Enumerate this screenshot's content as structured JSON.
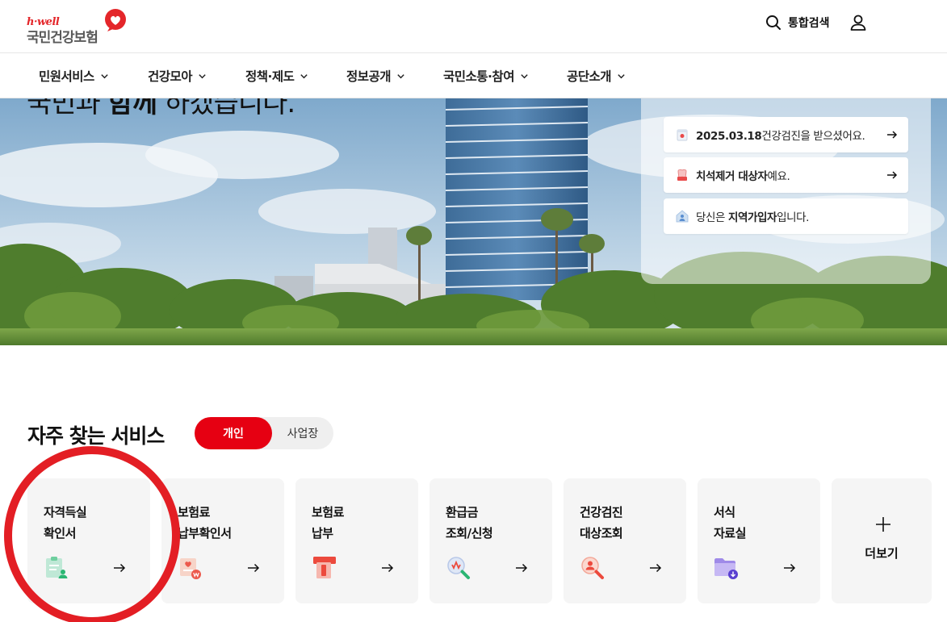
{
  "header": {
    "logo_sub": "h·well",
    "logo_main": "국민건강보험",
    "search_label": "통합검색"
  },
  "nav": {
    "items": [
      {
        "label": "민원서비스"
      },
      {
        "label": "건강모아"
      },
      {
        "label": "정책·제도"
      },
      {
        "label": "정보공개"
      },
      {
        "label": "국민소통·참여"
      },
      {
        "label": "공단소개"
      }
    ]
  },
  "hero": {
    "title_part1": "국민과 ",
    "title_part2": "함께",
    "title_part3": " 하겠습니다."
  },
  "notices": [
    {
      "bold": "2025.03.18",
      "text": "건강검진을 받으셨어요.",
      "icon": "checkup-calendar-icon"
    },
    {
      "bold": "치석제거 대상자",
      "text": "예요.",
      "icon": "tooth-icon"
    },
    {
      "prefix": "당신은 ",
      "bold": "지역가입자",
      "text": "입니다.",
      "icon": "home-person-icon"
    }
  ],
  "services": {
    "title": "자주 찾는 서비스",
    "toggle_on": "개인",
    "toggle_off": "사업장",
    "cards": [
      {
        "line1": "자격득실",
        "line2": "확인서",
        "icon": "certificate-person-icon"
      },
      {
        "line1": "보험료",
        "line2": "납부확인서",
        "icon": "payment-receipt-icon"
      },
      {
        "line1": "보험료",
        "line2": "납부",
        "icon": "card-payment-icon"
      },
      {
        "line1": "환급금",
        "line2": "조회/신청",
        "icon": "refund-search-icon"
      },
      {
        "line1": "건강검진",
        "line2": "대상조회",
        "icon": "checkup-search-icon"
      },
      {
        "line1": "서식",
        "line2": "자료실",
        "icon": "folder-download-icon"
      }
    ],
    "more_label": "더보기"
  },
  "colors": {
    "accent": "#e60012",
    "card_bg": "#f5f5f5",
    "annotation_circle": "#e31e24"
  }
}
